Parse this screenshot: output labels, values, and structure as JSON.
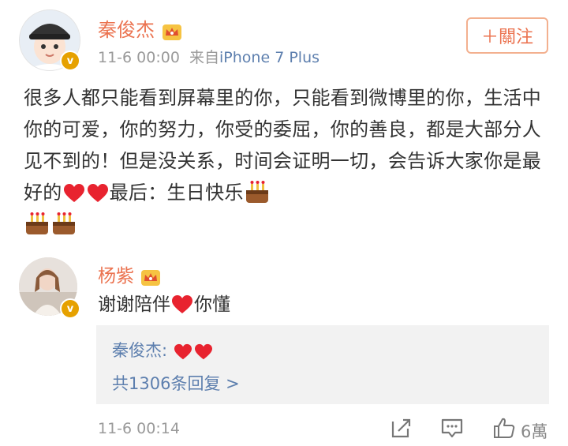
{
  "post": {
    "author": "秦俊杰",
    "time": "11-6 00:00",
    "source_prefix": "来自",
    "source": "iPhone 7 Plus",
    "follow_label": "＋關注",
    "verified_mark": "v",
    "text_part1": "很多人都只能看到屏幕里的你，只能看到微博里的你，生活中你的可爱，你的努力，你受的委屈，你的善良，都是大部分人见不到的！但是没关系，时间会证明一切，会告诉大家你是最好的",
    "text_part2": "最后：生日快乐",
    "emoji_after_part1": [
      "heart-icon",
      "heart-icon"
    ],
    "emoji_after_part2": [
      "cake-icon",
      "cake-icon",
      "cake-icon"
    ]
  },
  "comment": {
    "author": "杨紫",
    "text": "谢谢陪伴",
    "text_suffix": "你懂",
    "verified_mark": "v",
    "reply": {
      "author_label": "秦俊杰:",
      "more_replies": "共1306条回复 >"
    },
    "time": "11-6 00:14",
    "like_count": "6萬"
  },
  "colors": {
    "name": "#eb7350",
    "link": "#5d7fae",
    "meta": "#9a9a9a",
    "heart": "#e8232f",
    "badge": "#e6a100"
  }
}
